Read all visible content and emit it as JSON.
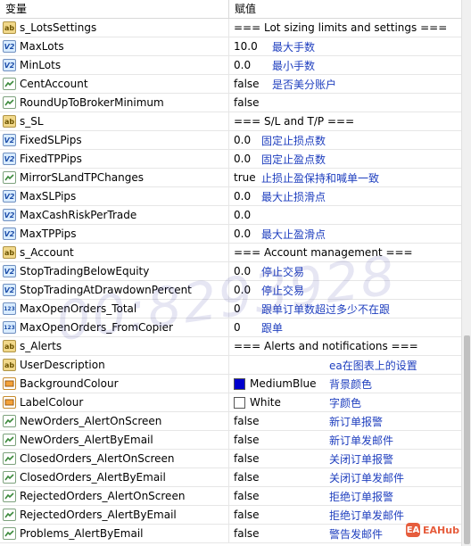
{
  "header": {
    "col_variable": "变量",
    "col_value": "赋值"
  },
  "rows": [
    {
      "icon": "ab",
      "name": "s_LotsSettings",
      "value": "=== Lot sizing limits and settings ===",
      "note": ""
    },
    {
      "icon": "va",
      "name": "MaxLots",
      "value": "10.0",
      "note": "最大手数"
    },
    {
      "icon": "va",
      "name": "MinLots",
      "value": "0.0",
      "note": "最小手数"
    },
    {
      "icon": "bool",
      "name": "CentAccount",
      "value": "false",
      "note": "是否美分账户"
    },
    {
      "icon": "bool",
      "name": "RoundUpToBrokerMinimum",
      "value": "false",
      "note": ""
    },
    {
      "icon": "ab",
      "name": "s_SL",
      "value": "=== S/L and T/P ===",
      "note": ""
    },
    {
      "icon": "va",
      "name": "FixedSLPips",
      "value": "0.0",
      "note": "固定止损点数"
    },
    {
      "icon": "va",
      "name": "FixedTPPips",
      "value": "0.0",
      "note": "固定止盈点数"
    },
    {
      "icon": "bool",
      "name": "MirrorSLandTPChanges",
      "value": "true",
      "note": "止损止盈保持和喊单一致"
    },
    {
      "icon": "va",
      "name": "MaxSLPips",
      "value": "0.0",
      "note": "最大止损滑点"
    },
    {
      "icon": "va",
      "name": "MaxCashRiskPerTrade",
      "value": "0.0",
      "note": ""
    },
    {
      "icon": "va",
      "name": "MaxTPPips",
      "value": "0.0",
      "note": "最大止盈滑点"
    },
    {
      "icon": "ab",
      "name": "s_Account",
      "value": "=== Account management ===",
      "note": ""
    },
    {
      "icon": "va",
      "name": "StopTradingBelowEquity",
      "value": "0.0",
      "note": "停止交易"
    },
    {
      "icon": "va",
      "name": "StopTradingAtDrawdownPercent",
      "value": "0.0",
      "note": "停止交易"
    },
    {
      "icon": "n123",
      "name": "MaxOpenOrders_Total",
      "value": "0",
      "note": "跟单订单数超过多少不在跟"
    },
    {
      "icon": "n123",
      "name": "MaxOpenOrders_FromCopier",
      "value": "0",
      "note": "跟单"
    },
    {
      "icon": "ab",
      "name": "s_Alerts",
      "value": "=== Alerts and notifications ===",
      "note": ""
    },
    {
      "icon": "ab",
      "name": "UserDescription",
      "value": "",
      "note": "ea在图表上的设置"
    },
    {
      "icon": "col",
      "name": "BackgroundColour",
      "value": "MediumBlue",
      "note": "背景颜色",
      "swatch": "#0000cd"
    },
    {
      "icon": "col",
      "name": "LabelColour",
      "value": "White",
      "note": "字颜色",
      "swatch": "#ffffff"
    },
    {
      "icon": "bool",
      "name": "NewOrders_AlertOnScreen",
      "value": "false",
      "note": "新订单报警"
    },
    {
      "icon": "bool",
      "name": "NewOrders_AlertByEmail",
      "value": "false",
      "note": "新订单发邮件"
    },
    {
      "icon": "bool",
      "name": "ClosedOrders_AlertOnScreen",
      "value": "false",
      "note": "关闭订单报警"
    },
    {
      "icon": "bool",
      "name": "ClosedOrders_AlertByEmail",
      "value": "false",
      "note": "关闭订单发邮件"
    },
    {
      "icon": "bool",
      "name": "RejectedOrders_AlertOnScreen",
      "value": "false",
      "note": "拒绝订单报警"
    },
    {
      "icon": "bool",
      "name": "RejectedOrders_AlertByEmail",
      "value": "false",
      "note": "拒绝订单发邮件"
    },
    {
      "icon": "bool",
      "name": "Problems_AlertByEmail",
      "value": "false",
      "note": "警告发邮件"
    }
  ],
  "watermark": "00:8293928",
  "logo": {
    "text": "EAHub",
    "mark": "EA"
  },
  "colors": {
    "note_text": "#1f3fbf",
    "logo": "#e65d3d"
  }
}
